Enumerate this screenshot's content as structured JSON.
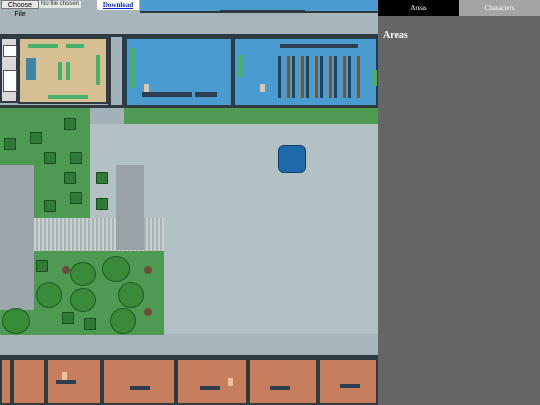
{
  "toolbar": {
    "choose_file_label": "Choose File",
    "no_file_text": "No file chosen",
    "download_label": "Download"
  },
  "panel": {
    "tabs": [
      {
        "label": "Areas",
        "active": true
      },
      {
        "label": "Characters",
        "active": false
      }
    ],
    "title": "Areas"
  },
  "colors": {
    "panel_bg": "#666666",
    "active_tab": "#000000",
    "inactive_tab": "#a5a5a5",
    "floor": "#a3b2b8",
    "grass": "#4e9a52",
    "office_blue": "#4a9bd0",
    "office_brown": "#c67e5d",
    "link": "#0b24d6"
  }
}
